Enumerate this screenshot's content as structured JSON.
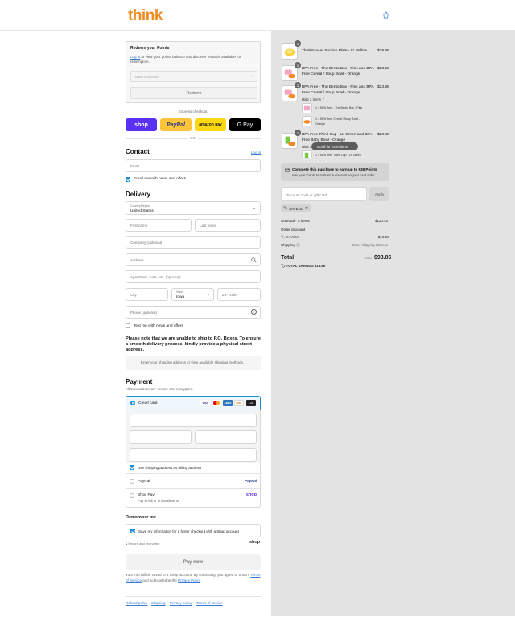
{
  "header": {
    "logo": "think",
    "cart_icon": "shopping-bag-icon"
  },
  "points": {
    "title": "Redeem your Points",
    "desc_link": "Log in",
    "desc_text": " to view your points balance and discover rewards available for redemption.",
    "select_placeholder": "Select a discount",
    "redeem_label": "Redeem"
  },
  "express": {
    "title": "Express checkout",
    "shop": "shop",
    "paypal": "PayPal",
    "amazon": "amazon pay",
    "gpay": "G Pay",
    "or": "OR"
  },
  "contact": {
    "title": "Contact",
    "login": "Log in",
    "email_placeholder": "Email",
    "news_label": "Email me with news and offers"
  },
  "delivery": {
    "title": "Delivery",
    "country_label": "Country/Region",
    "country_value": "United States",
    "first_name": "First name",
    "last_name": "Last name",
    "company": "Company (optional)",
    "address": "Address",
    "apartment": "Apartment, suite, etc. (optional)",
    "city": "City",
    "state_label": "State",
    "state_value": "Iowa",
    "zip": "ZIP code",
    "phone": "Phone (optional)",
    "text_label": "Text me with news and offers",
    "notice": "Please note that we are unable to ship to P.O. Boxes. To ensure a smooth delivery process, kindly provide a physical street address.",
    "shipping_placeholder": "Enter your shipping address to view available shipping methods."
  },
  "payment": {
    "title": "Payment",
    "subtitle": "All transactions are secure and encrypted.",
    "credit_card": "Credit card",
    "card_logos": [
      "VISA",
      "MC",
      "AMEX",
      "DISC",
      "+4"
    ],
    "billing_label": "Use shipping address as billing address",
    "paypal": "PayPal",
    "paypal_logo": "PayPal",
    "shoppay": "Shop Pay",
    "shoppay_sub": "Pay in full or in installments",
    "shoppay_logo": "shop"
  },
  "remember": {
    "title": "Remember me",
    "save_label": "Save my information for a faster checkout with a Shop account",
    "secure": "Secure and encrypted",
    "shop_logo": "shop"
  },
  "pay_now": "Pay now",
  "legal": {
    "text1": "Your info will be saved to a Shop account. By continuing, you agree to Shop's ",
    "terms": "Terms of Service",
    "text2": " and acknowledge the ",
    "privacy": "Privacy Policy",
    "text3": "."
  },
  "footer": [
    "Refund policy",
    "Shipping",
    "Privacy policy",
    "Terms of service"
  ],
  "cart": {
    "items": [
      {
        "title": "ThinkSaucer Suction Plate - Lt. Yellow",
        "price": "$19.99",
        "qty": "1"
      },
      {
        "title": "BPA Free - The Bento Box - Pink and BPA Free Cereal / Soup Bowl - Orange",
        "price": "$23.98",
        "qty": "1"
      },
      {
        "title": "BPA Free - The Bento Box - Pink and BPA Free Cereal / Soup Bowl - Orange",
        "price": "$23.98",
        "qty": "1",
        "hide": "Hide 2 items",
        "sub": [
          "1 × BPA Free - The Bento Box - Pink",
          "1 × BPA Free Cereal / Soup Bowl - Orange"
        ]
      },
      {
        "title": "BPA Free Think Cup - Lt. Green and BPA Free Baby Bowl - Orange",
        "price": "$20.48",
        "qty": "1",
        "hide": "Hide 2",
        "sub": [
          "1 × BPA Free Think Cup - Lt. Green"
        ]
      }
    ],
    "scroll_tip": "Scroll for more items",
    "points_title": "Complete this purchase to earn up to 938 Points",
    "points_sub": "Use your Points to redeem a discount on your next order",
    "discount_placeholder": "Discount code or gift card",
    "apply": "Apply",
    "code": "SAVE15",
    "subtotal_label": "Subtotal · 5 items",
    "subtotal": "$110.42",
    "order_discount": "Order discount",
    "discount_code": "SAVE15",
    "discount_value": "- $16.56",
    "shipping_label": "Shipping",
    "shipping_value": "Enter shipping address",
    "total_label": "Total",
    "currency": "USD",
    "total": "$93.86",
    "savings_label": "TOTAL SAVINGS",
    "savings": "$16.56"
  }
}
